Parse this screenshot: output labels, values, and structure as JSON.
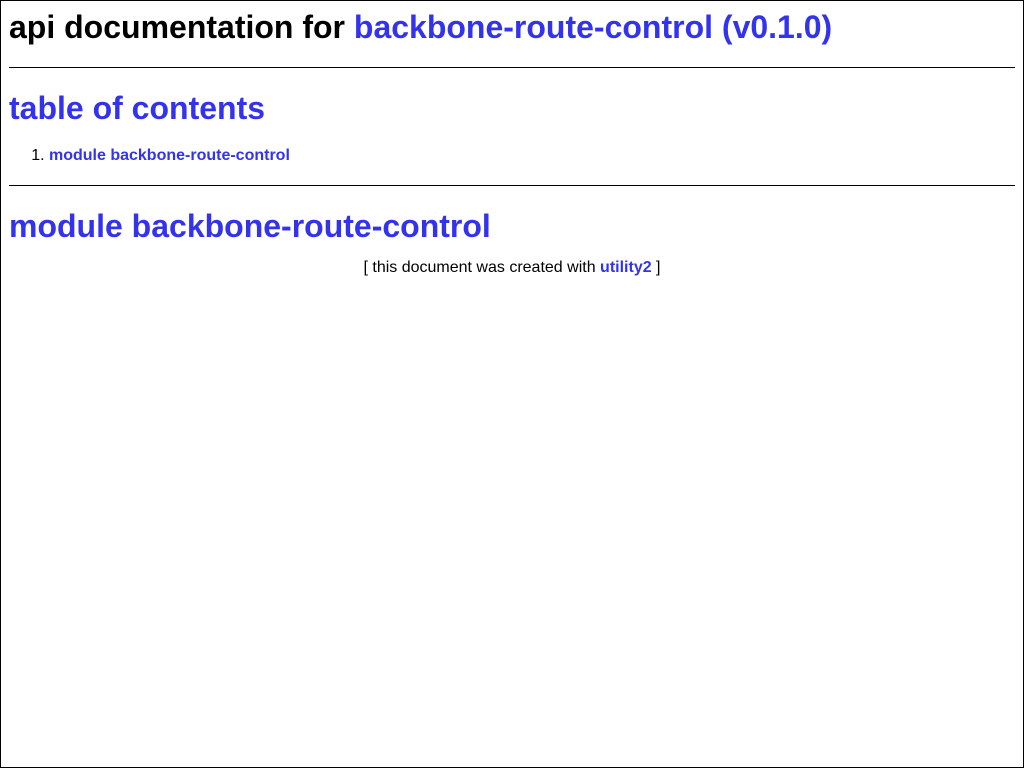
{
  "header": {
    "title_prefix": "api documentation for ",
    "title_link": "backbone-route-control (v0.1.0)"
  },
  "toc": {
    "title": "table of contents",
    "items": [
      {
        "number": "1.",
        "label": "module backbone-route-control"
      }
    ]
  },
  "module": {
    "title": "module backbone-route-control"
  },
  "footer": {
    "prefix": "[ this document was created with ",
    "link": "utility2",
    "suffix": " ]"
  },
  "colors": {
    "link": "#3333ee",
    "text": "#000000",
    "background": "#ffffff"
  }
}
